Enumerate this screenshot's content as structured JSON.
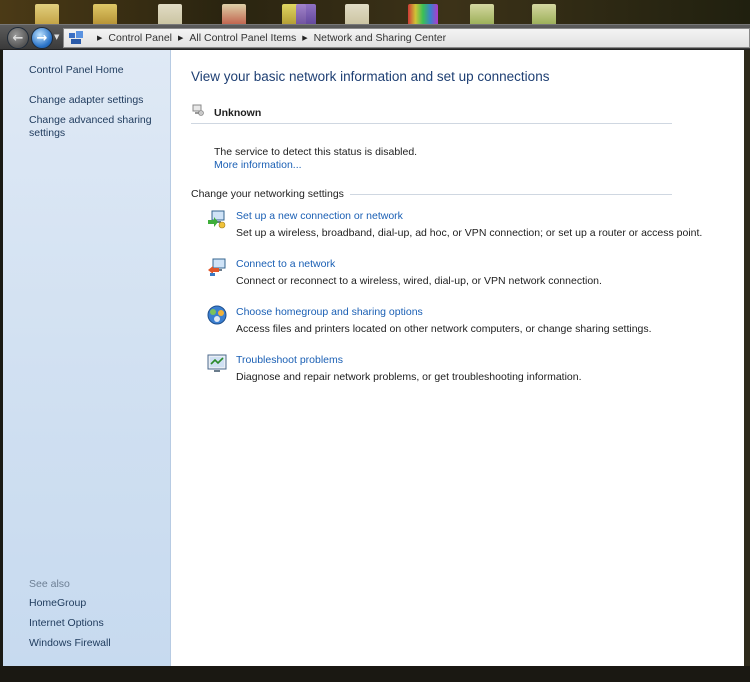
{
  "address_bar": {
    "crumbs": [
      "Control Panel",
      "All Control Panel Items",
      "Network and Sharing Center"
    ]
  },
  "sidebar": {
    "home": "Control Panel Home",
    "links": [
      "Change adapter settings",
      "Change advanced sharing settings"
    ],
    "see_also_label": "See also",
    "see_also": [
      "HomeGroup",
      "Internet Options",
      "Windows Firewall"
    ]
  },
  "main": {
    "heading": "View your basic network information and set up connections",
    "status": {
      "name": "Unknown",
      "message": "The service to detect this status is disabled.",
      "more_info": "More information..."
    },
    "section_label": "Change your networking settings",
    "tasks": [
      {
        "title": "Set up a new connection or network",
        "desc": "Set up a wireless, broadband, dial-up, ad hoc, or VPN connection; or set up a router or access point.",
        "icon": "new-connection-icon"
      },
      {
        "title": "Connect to a network",
        "desc": "Connect or reconnect to a wireless, wired, dial-up, or VPN network connection.",
        "icon": "connect-network-icon"
      },
      {
        "title": "Choose homegroup and sharing options",
        "desc": "Access files and printers located on other network computers, or change sharing settings.",
        "icon": "homegroup-icon"
      },
      {
        "title": "Troubleshoot problems",
        "desc": "Diagnose and repair network problems, or get troubleshooting information.",
        "icon": "troubleshoot-icon"
      }
    ]
  },
  "colors": {
    "link": "#1a5fb4",
    "heading": "#1e3f73",
    "sidebar_bg": "#d6e4f3"
  }
}
